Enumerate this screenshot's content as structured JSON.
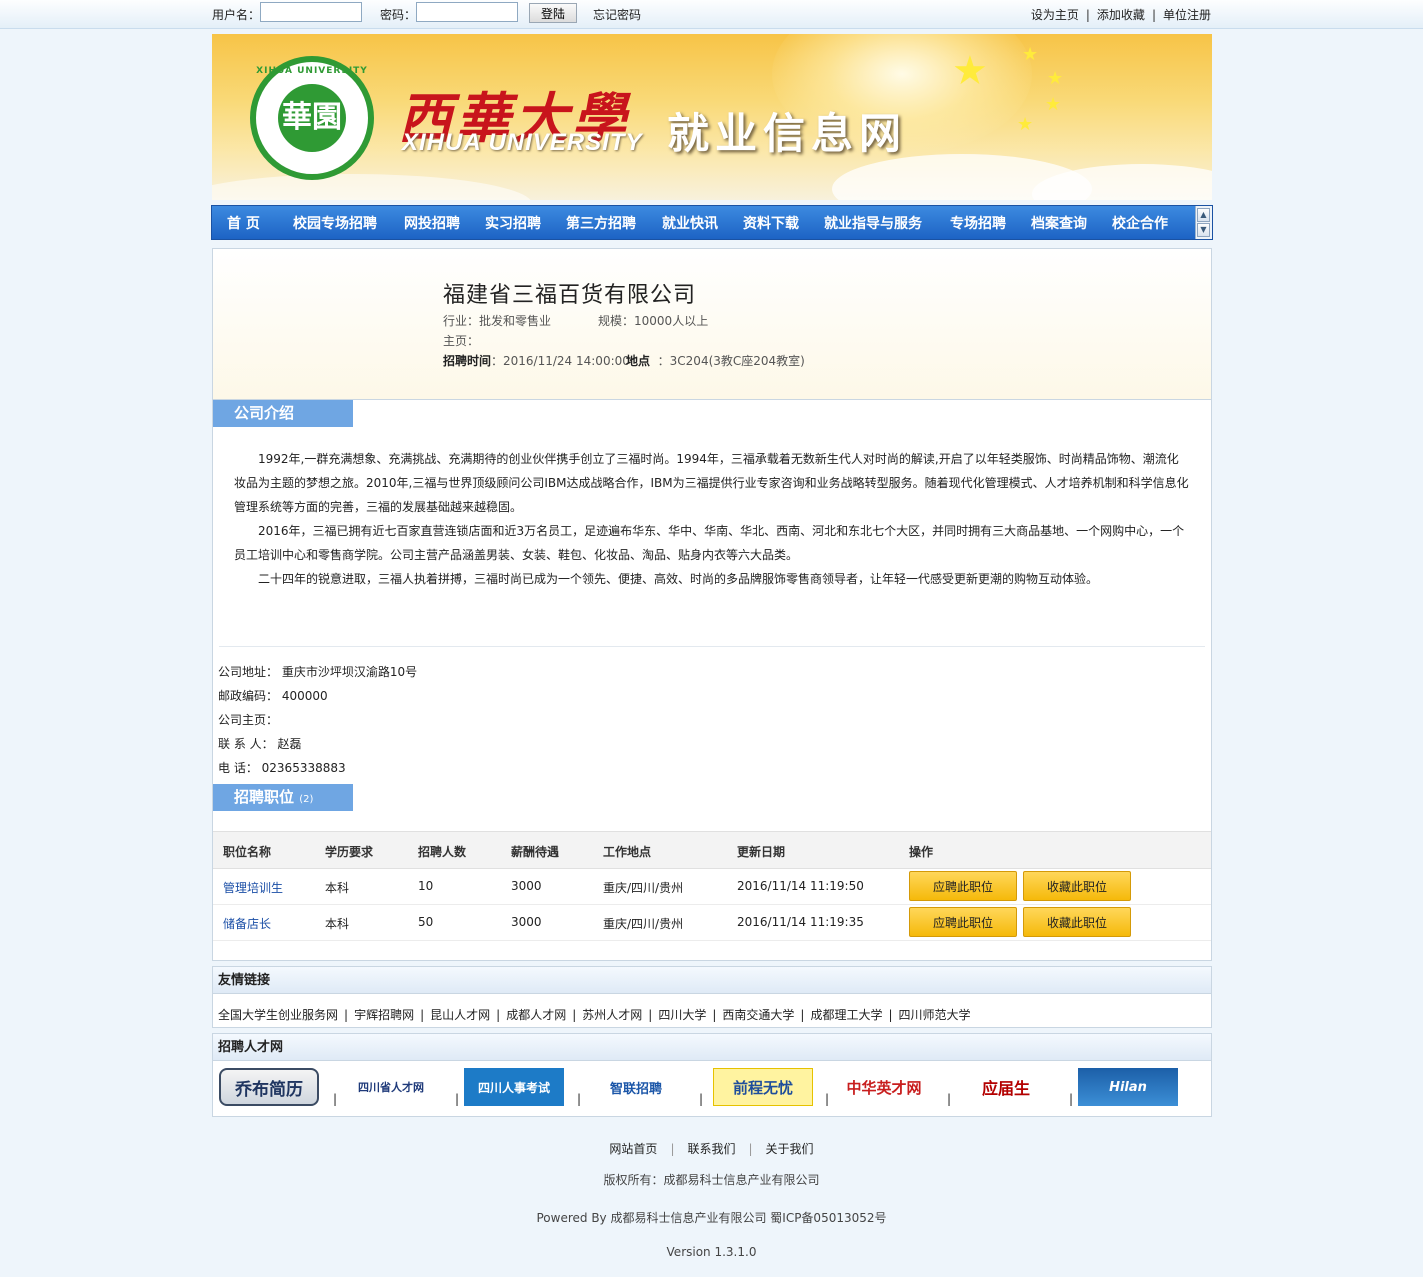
{
  "topbar": {
    "username_label": "用户名：",
    "password_label": "密码：",
    "login_button": "登陆",
    "forgot_password": "忘记密码",
    "links": [
      "设为主页",
      "添加收藏",
      "单位注册"
    ]
  },
  "banner": {
    "cn_title": "西華大學",
    "en_title": "XIHUA UNIVERSITY",
    "site_title": "就业信息网",
    "logo_ring_text": "XIHUA UNIVERSITY",
    "logo_center_text": "華園"
  },
  "nav": {
    "items": [
      "首  页",
      "校园专场招聘",
      "网投招聘",
      "实习招聘",
      "第三方招聘",
      "就业快讯",
      "资料下载",
      "就业指导与服务",
      "专场招聘",
      "档案查询",
      "校企合作"
    ]
  },
  "company": {
    "name": "福建省三福百货有限公司",
    "industry_label": "行业：",
    "industry": "批发和零售业",
    "scale_label": "规模：",
    "scale": "10000人以上",
    "homepage_label": "主页：",
    "time_label": "招聘时间",
    "time_value": "：2016/11/24 14:00:00",
    "place_label": "地点",
    "place_value": "：3C204(3教C座204教室)"
  },
  "intro": {
    "title": "公司介绍",
    "paragraphs": [
      "1992年,一群充满想象、充满挑战、充满期待的创业伙伴携手创立了三福时尚。1994年，三福承载着无数新生代人对时尚的解读,开启了以年轻类服饰、时尚精品饰物、潮流化妆品为主题的梦想之旅。2010年,三福与世界顶级顾问公司IBM达成战略合作，IBM为三福提供行业专家咨询和业务战略转型服务。随着现代化管理模式、人才培养机制和科学信息化管理系统等方面的完善，三福的发展基础越来越稳固。",
      "2016年，三福已拥有近七百家直营连锁店面和近3万名员工，足迹遍布华东、华中、华南、华北、西南、河北和东北七个大区，并同时拥有三大商品基地、一个网购中心，一个员工培训中心和零售商学院。公司主营产品涵盖男装、女装、鞋包、化妆品、淘品、贴身内衣等六大品类。",
      "二十四年的锐意进取，三福人执着拼搏，三福时尚已成为一个领先、便捷、高效、时尚的多品牌服饰零售商领导者，让年轻一代感受更新更潮的购物互动体验。"
    ]
  },
  "contact": {
    "address_label": "公司地址：",
    "address": "重庆市沙坪坝汉渝路10号",
    "zip_label": "邮政编码：",
    "zip": "400000",
    "homepage_label": "公司主页：",
    "contact_label": "联 系 人：",
    "contact": "赵磊",
    "phone_label": "电  话：",
    "phone": "02365338883"
  },
  "jobs": {
    "title": "招聘职位",
    "count": "(2)",
    "headers": [
      "职位名称",
      "学历要求",
      "招聘人数",
      "薪酬待遇",
      "工作地点",
      "更新日期",
      "操作"
    ],
    "apply_label": "应聘此职位",
    "favorite_label": "收藏此职位",
    "rows": [
      {
        "name": "管理培训生",
        "education": "本科",
        "count": "10",
        "salary": "3000",
        "location": "重庆/四川/贵州",
        "updated": "2016/11/14 11:19:50"
      },
      {
        "name": "储备店长",
        "education": "本科",
        "count": "50",
        "salary": "3000",
        "location": "重庆/四川/贵州",
        "updated": "2016/11/14 11:19:35"
      }
    ]
  },
  "friend_links": {
    "title": "友情链接",
    "items": [
      "全国大学生创业服务网",
      "宇辉招聘网",
      "昆山人才网",
      "成都人才网",
      "苏州人才网",
      "四川大学",
      "西南交通大学",
      "成都理工大学",
      "四川师范大学"
    ]
  },
  "talent_sites": {
    "title": "招聘人才网",
    "logos": [
      "乔布简历",
      "四川省人才网",
      "四川人事考试",
      "智联招聘",
      "前程无忧",
      "中华英才网",
      "应届生",
      "Hilan"
    ]
  },
  "footer": {
    "links": [
      "网站首页",
      "联系我们",
      "关于我们"
    ],
    "copyright": "版权所有：成都易科士信息产业有限公司",
    "powered": "Powered By 成都易科士信息产业有限公司 蜀ICP备05013052号",
    "version": "Version 1.3.1.0"
  }
}
